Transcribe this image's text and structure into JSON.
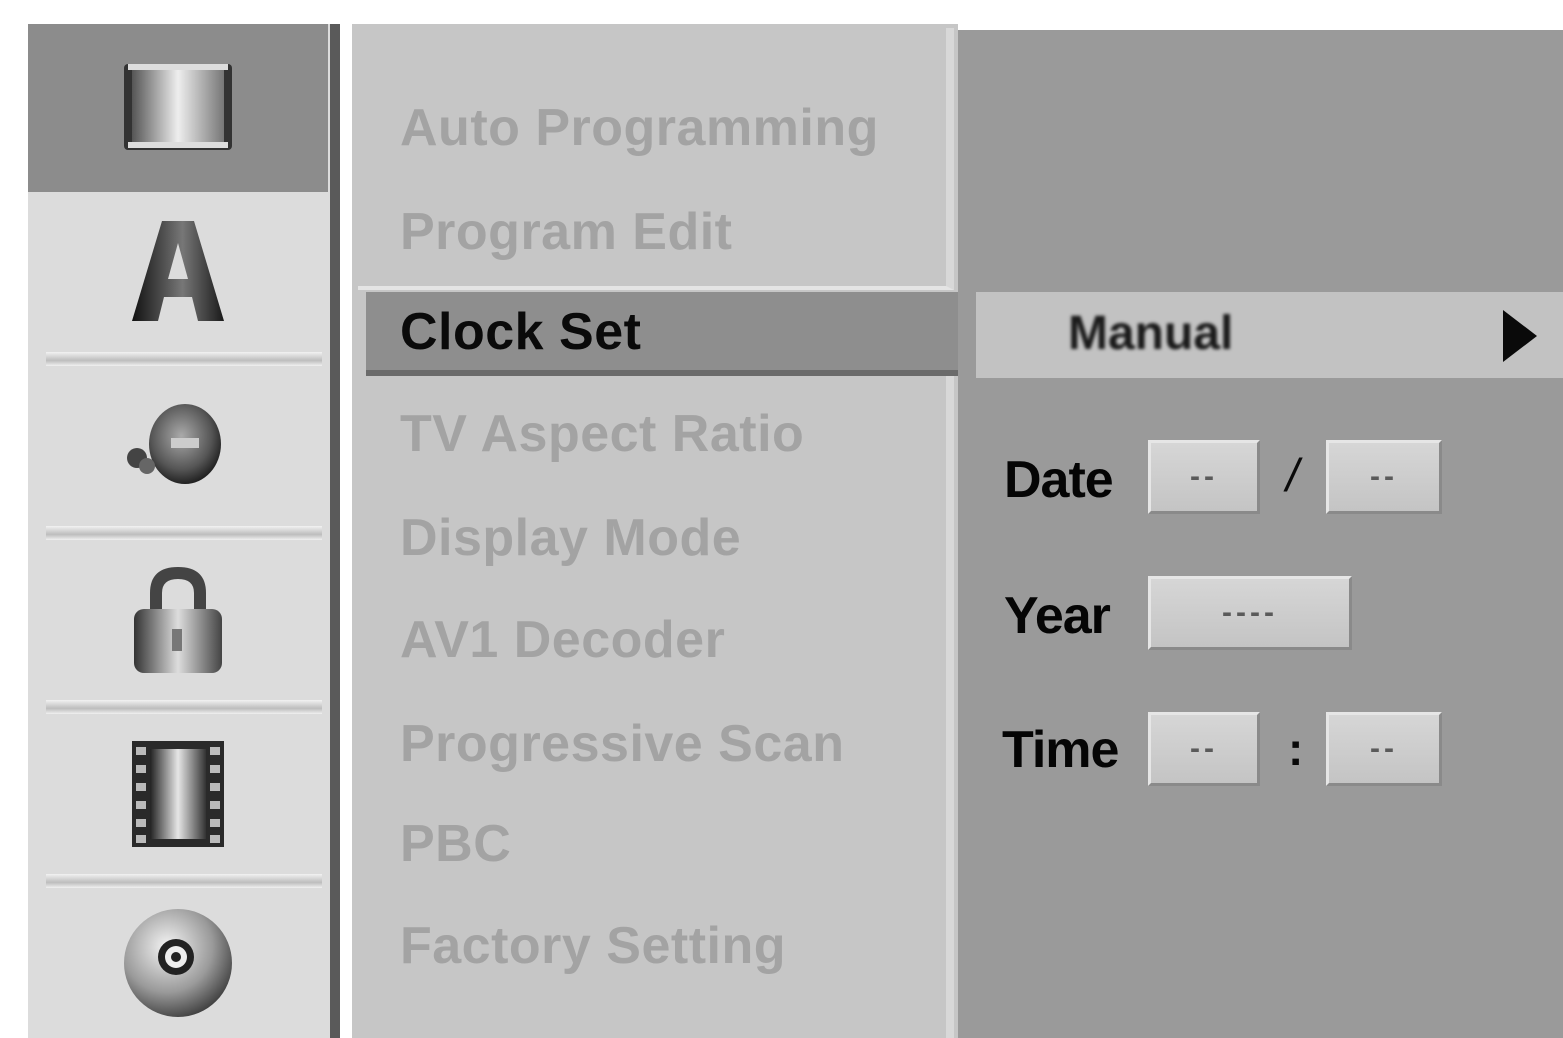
{
  "sidebar": {
    "icons": [
      "tv-screen-icon",
      "language-a-icon",
      "audio-speaker-icon",
      "lock-icon",
      "film-strip-icon",
      "disc-icon"
    ],
    "active_index": 0
  },
  "menu": {
    "items": [
      {
        "label": "Auto Programming"
      },
      {
        "label": "Program Edit"
      },
      {
        "label": "Clock Set"
      },
      {
        "label": "TV Aspect Ratio"
      },
      {
        "label": "Display Mode"
      },
      {
        "label": "AV1 Decoder"
      },
      {
        "label": "Progressive Scan"
      },
      {
        "label": "PBC"
      },
      {
        "label": "Factory Setting"
      }
    ],
    "selected_index": 2
  },
  "panel": {
    "mode": "Manual",
    "date_label": "Date",
    "date_month": "--",
    "date_sep": "/",
    "date_day": "--",
    "year_label": "Year",
    "year_value": "----",
    "time_label": "Time",
    "time_hour": "--",
    "time_sep": ":",
    "time_min": "--"
  }
}
